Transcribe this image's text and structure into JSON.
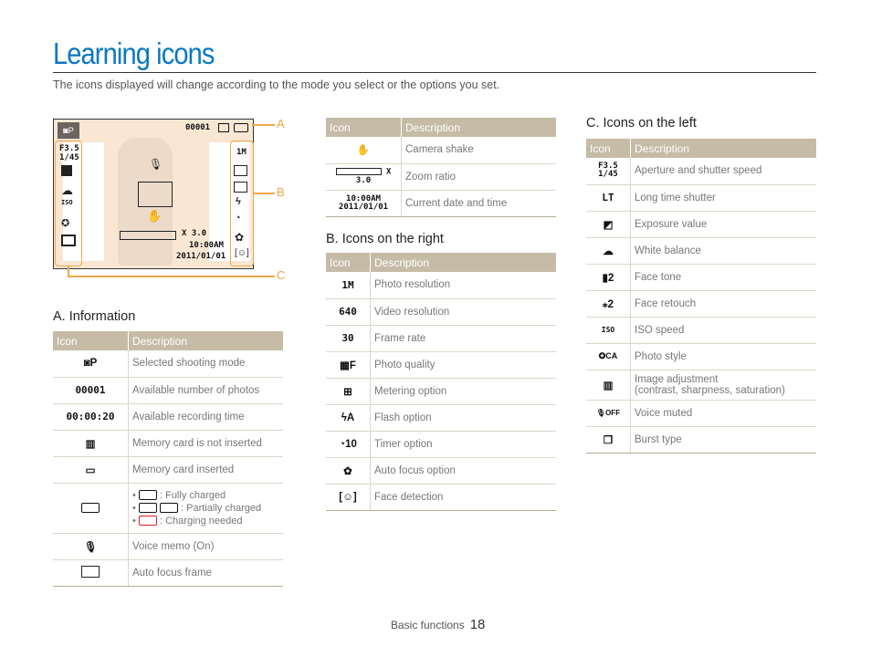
{
  "page": {
    "title": "Learning icons",
    "subtitle": "The icons displayed will change according to the mode you select or the options you set.",
    "footer_section": "Basic functions",
    "page_number": "18"
  },
  "camera_preview": {
    "mode_icon": "camera-p",
    "count": "00001",
    "aperture": "F3.5",
    "shutter": "1/45",
    "zoom": "X 3.0",
    "time": "10:00AM",
    "date": "2011/01/01",
    "callouts": [
      "A",
      "B",
      "C"
    ]
  },
  "section_a": {
    "title": "A. Information",
    "headers": [
      "Icon",
      "Description"
    ],
    "rows": [
      {
        "icon": "camera-p",
        "icon_text": "◙P",
        "desc": "Selected shooting mode"
      },
      {
        "icon": "photo-count",
        "icon_text": "00001",
        "desc": "Available number of photos"
      },
      {
        "icon": "recording-time",
        "icon_text": "00:00:20",
        "desc": "Available recording time"
      },
      {
        "icon": "memory-card-absent",
        "icon_text": "▥",
        "desc": "Memory card is not inserted"
      },
      {
        "icon": "memory-card",
        "icon_text": "▭",
        "desc": "Memory card inserted"
      },
      {
        "icon": "battery",
        "icon_text": "▮▮▮",
        "desc_list": [
          ": Fully charged",
          ": Partially charged",
          ": Charging needed"
        ]
      },
      {
        "icon": "microphone",
        "icon_text": "🎙",
        "desc": "Voice memo (On)"
      },
      {
        "icon": "focus-frame",
        "icon_text": "▭",
        "desc": "Auto focus frame"
      }
    ]
  },
  "section_top": {
    "headers": [
      "Icon",
      "Description"
    ],
    "rows": [
      {
        "icon": "hand-shake",
        "icon_text": "✋",
        "desc": "Camera shake"
      },
      {
        "icon": "zoom-bar",
        "icon_text": "X 3.0",
        "desc": "Zoom ratio"
      },
      {
        "icon": "date-time",
        "icon_text": "10:00AM 2011/01/01",
        "desc": "Current date and time"
      }
    ]
  },
  "section_b": {
    "title": "B. Icons on the right",
    "headers": [
      "Icon",
      "Description"
    ],
    "rows": [
      {
        "icon": "photo-resolution",
        "icon_text": "1M",
        "desc": "Photo resolution"
      },
      {
        "icon": "video-resolution",
        "icon_text": "640",
        "desc": "Video resolution"
      },
      {
        "icon": "frame-rate",
        "icon_text": "30",
        "desc": "Frame rate"
      },
      {
        "icon": "photo-quality",
        "icon_text": "▦F",
        "desc": "Photo quality"
      },
      {
        "icon": "metering",
        "icon_text": "⊞",
        "desc": "Metering option"
      },
      {
        "icon": "flash",
        "icon_text": "ϟA",
        "desc": "Flash option"
      },
      {
        "icon": "timer",
        "icon_text": "◔10",
        "desc": "Timer option"
      },
      {
        "icon": "macro-flower",
        "icon_text": "✿",
        "desc": "Auto focus option"
      },
      {
        "icon": "face-detect",
        "icon_text": "[☺]",
        "desc": "Face detection"
      }
    ]
  },
  "section_c": {
    "title": "C. Icons on the left",
    "headers": [
      "Icon",
      "Description"
    ],
    "rows": [
      {
        "icon": "aperture-shutter",
        "icon_text": "F3.5 1/45",
        "desc": "Aperture and shutter speed"
      },
      {
        "icon": "long-time",
        "icon_text": "LT",
        "desc": "Long time shutter"
      },
      {
        "icon": "exposure",
        "icon_text": "◩",
        "desc": "Exposure value"
      },
      {
        "icon": "cloud",
        "icon_text": "☁",
        "desc": "White balance"
      },
      {
        "icon": "face-tone",
        "icon_text": "▮2",
        "desc": "Face tone"
      },
      {
        "icon": "face-retouch",
        "icon_text": "⁎2",
        "desc": "Face retouch"
      },
      {
        "icon": "iso",
        "icon_text": "ISO",
        "desc": "ISO speed"
      },
      {
        "icon": "photo-style",
        "icon_text": "✪CA",
        "desc": "Photo style"
      },
      {
        "icon": "image-adjust",
        "icon_text": "▥",
        "desc": "Image adjustment",
        "desc2": "(contrast, sharpness, saturation)"
      },
      {
        "icon": "voice-off",
        "icon_text": "🎙OFF",
        "desc": "Voice muted"
      },
      {
        "icon": "burst",
        "icon_text": "❐",
        "desc": "Burst type"
      }
    ]
  },
  "colors": {
    "title": "#0a78c2",
    "header": "#c6bba6",
    "callout": "#f0a64a",
    "battery_low": "#e02020"
  }
}
